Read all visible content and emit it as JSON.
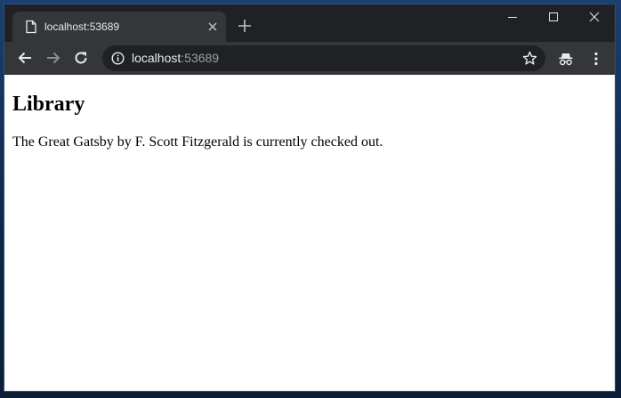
{
  "browser": {
    "tab": {
      "title": "localhost:53689",
      "favicon_icon": "page-icon",
      "close_icon": "close-icon"
    },
    "new_tab_icon": "plus-icon",
    "window_controls": [
      "minimize-icon",
      "maximize-icon",
      "close-icon"
    ],
    "toolbar": {
      "back_icon": "back-arrow-icon",
      "forward_icon": "forward-arrow-icon",
      "reload_icon": "reload-icon",
      "site_info_icon": "info-icon",
      "address": {
        "host": "localhost",
        "port": ":53689"
      },
      "bookmark_icon": "star-icon",
      "incognito_icon": "incognito-icon",
      "menu_icon": "kebab-menu-icon"
    },
    "colors": {
      "frame": "#202124",
      "toolbar": "#35363a",
      "text": "#e8eaed",
      "muted": "#9aa0a6"
    }
  },
  "page": {
    "heading": "Library",
    "message": "The Great Gatsby by F. Scott Fitzgerald is currently checked out."
  }
}
